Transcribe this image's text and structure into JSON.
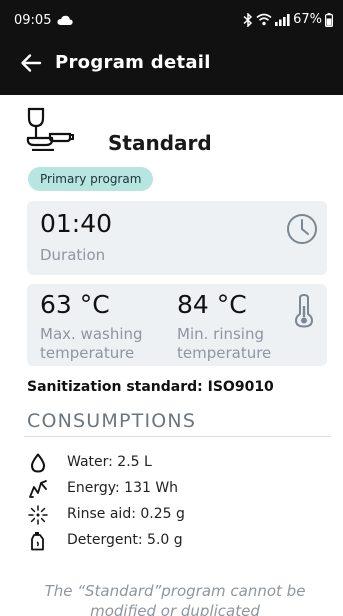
{
  "status_bar": {
    "time": "09:05",
    "battery": "67%",
    "icons": [
      "cloud-icon",
      "bluetooth-icon",
      "wifi-icon",
      "signal-icon",
      "battery-icon"
    ]
  },
  "app_bar": {
    "back_icon": "back-arrow-icon",
    "title": "Program detail"
  },
  "program": {
    "icon": "wineglass-plate-icon",
    "name": "Standard",
    "badge": "Primary program"
  },
  "duration": {
    "value": "01:40",
    "label": "Duration",
    "icon": "clock-icon"
  },
  "temperatures": {
    "max_washing_value": "63 °C",
    "max_washing_label_line1": "Max. washing",
    "max_washing_label_line2": "temperature",
    "min_rinsing_value": "84 °C",
    "min_rinsing_label_line1": "Min. rinsing",
    "min_rinsing_label_line2": "temperature",
    "icon": "thermometer-icon"
  },
  "sanitization": "Sanitization standard: ISO9010",
  "consumptions": {
    "title": "CONSUMPTIONS",
    "items": [
      {
        "icon": "water-drop-icon",
        "label": "Water: 2.5 L"
      },
      {
        "icon": "energy-icon",
        "label": "Energy: 131 Wh"
      },
      {
        "icon": "rinse-aid-icon",
        "label": "Rinse aid: 0.25 g"
      },
      {
        "icon": "detergent-icon",
        "label": "Detergent: 5.0 g"
      }
    ]
  },
  "footer_note_line1": "The “Standard”program cannot be",
  "footer_note_line2": "modified or duplicated",
  "colors": {
    "header_bg": "#111111",
    "badge_bg": "#b7e6e0",
    "card_bg": "#eef1f4",
    "muted_text": "#8f96a0"
  }
}
